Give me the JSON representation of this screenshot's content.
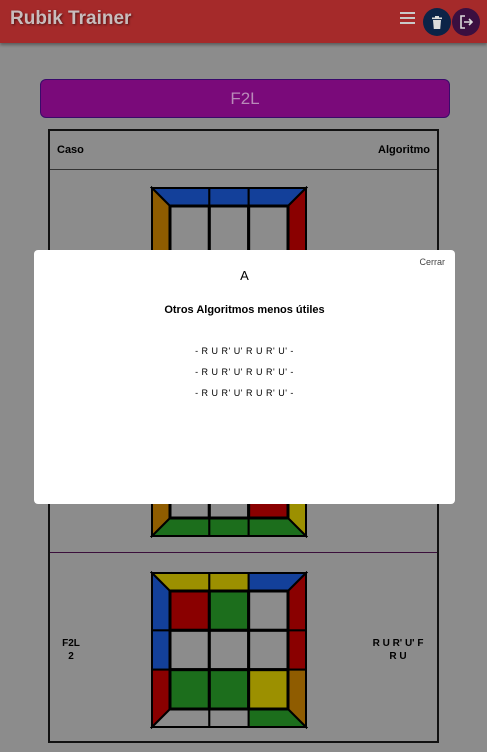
{
  "header": {
    "title": "Rubik Trainer",
    "icons": {
      "menu": "menu-icon",
      "delete": "trash-icon",
      "logout": "logout-icon"
    }
  },
  "section_button": {
    "label": "F2L"
  },
  "table": {
    "columns": {
      "case": "Caso",
      "algorithm": "Algoritmo"
    },
    "rows": [
      {
        "case": "",
        "algorithm": ""
      },
      {
        "case": "F2L\n2",
        "algorithm": "R U R' U' F\nR U"
      }
    ]
  },
  "modal": {
    "close_label": "Cerrar",
    "title": "A",
    "subtitle": "Otros Algoritmos menos útiles",
    "algorithms": [
      "- R U R' U' R U R' U' -",
      "- R U R' U' R U R' U' -",
      "- R U R' U' R U R' U' -"
    ]
  },
  "colors": {
    "header_bg": "#a52a2a",
    "section_bg": "#7a0a7a",
    "overlay_bg": "#8c8c8c",
    "cube": {
      "yellow": "#9c9000",
      "blue": "#13409a",
      "red": "#8a0000",
      "green": "#1c6e1c",
      "orange": "#8f5c00",
      "gray": "#8c8c8c"
    }
  },
  "cubes": [
    {
      "top_edge": [
        "blue",
        "blue",
        "blue"
      ],
      "left_edge": [
        "orange",
        "gray",
        "orange"
      ],
      "right_edge": [
        "red",
        "gray",
        "yellow"
      ],
      "bottom_edge": [
        "green",
        "green",
        "green"
      ],
      "face": [
        "gray",
        "gray",
        "gray",
        "gray",
        "gray",
        "gray",
        "gray",
        "gray",
        "red"
      ]
    },
    {
      "top_edge": [
        "yellow",
        "yellow",
        "blue"
      ],
      "left_edge": [
        "blue",
        "blue",
        "red"
      ],
      "right_edge": [
        "red",
        "red",
        "orange"
      ],
      "bottom_edge": [
        "gray",
        "gray",
        "green"
      ],
      "face": [
        "red",
        "green",
        "gray",
        "gray",
        "gray",
        "gray",
        "green",
        "green",
        "yellow"
      ]
    }
  ]
}
